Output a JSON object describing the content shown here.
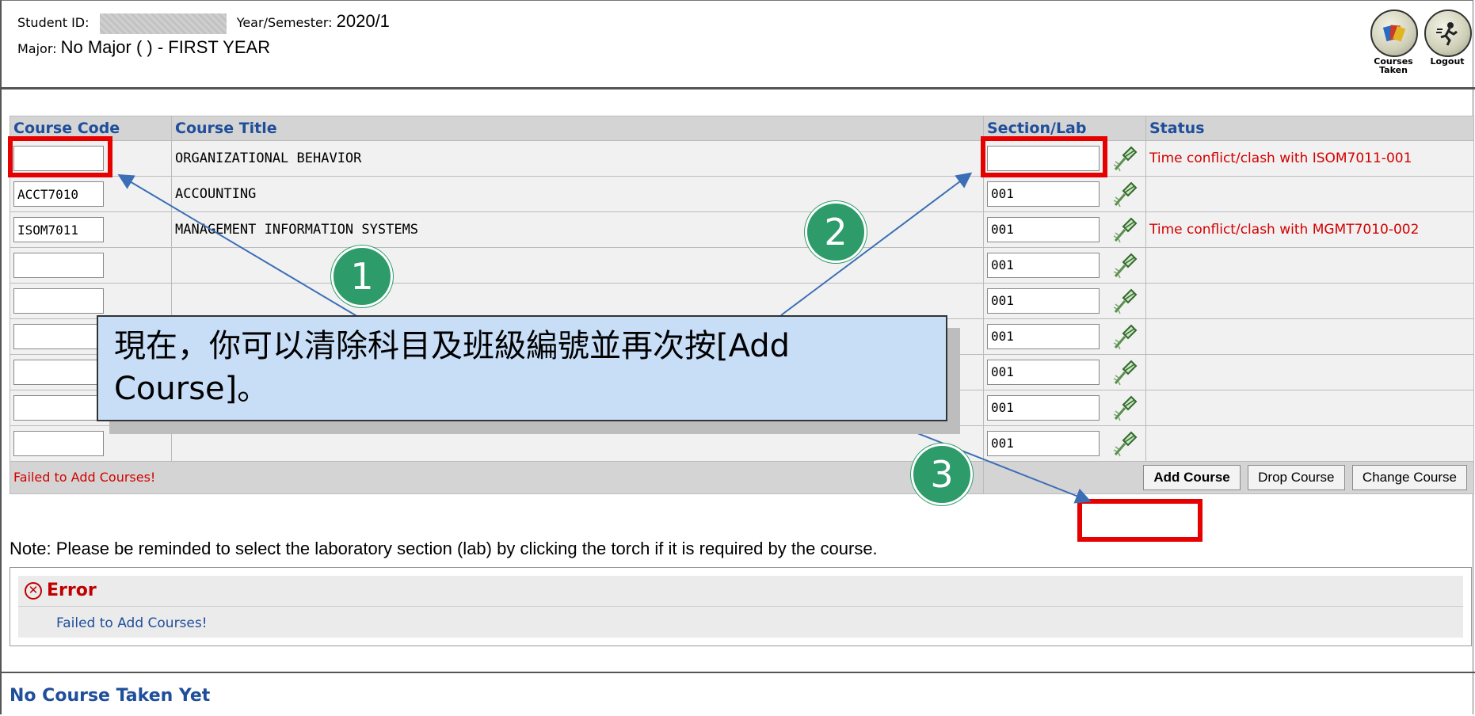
{
  "header": {
    "student_id_label": "Student ID:",
    "year_label": "Year/Semester:",
    "year_value": "2020/1",
    "major_label": "Major:",
    "major_value": "No Major ( ) - FIRST YEAR"
  },
  "top_icons": {
    "courses_taken_line1": "Courses",
    "courses_taken_line2": "Taken",
    "logout": "Logout"
  },
  "table": {
    "headers": [
      "Course Code",
      "Course Title",
      "Section/Lab",
      "Status"
    ],
    "rows": [
      {
        "code": "",
        "title": "ORGANIZATIONAL BEHAVIOR",
        "section": "",
        "status": "Time conflict/clash with ISOM7011-001"
      },
      {
        "code": "ACCT7010",
        "title": "ACCOUNTING",
        "section": "001",
        "status": ""
      },
      {
        "code": "ISOM7011",
        "title": "MANAGEMENT INFORMATION SYSTEMS",
        "section": "001",
        "status": "Time conflict/clash with MGMT7010-002"
      },
      {
        "code": "",
        "title": "",
        "section": "001",
        "status": ""
      },
      {
        "code": "",
        "title": "",
        "section": "001",
        "status": ""
      },
      {
        "code": "",
        "title": "",
        "section": "001",
        "status": ""
      },
      {
        "code": "",
        "title": "",
        "section": "001",
        "status": ""
      },
      {
        "code": "",
        "title": "",
        "section": "001",
        "status": ""
      },
      {
        "code": "",
        "title": "",
        "section": "001",
        "status": ""
      }
    ],
    "fail_message": "Failed to Add Courses!",
    "buttons": {
      "add": "Add Course",
      "drop": "Drop Course",
      "change": "Change Course"
    }
  },
  "note": "Note: Please be reminded to select the laboratory section (lab) by clicking the torch if it is required by the course.",
  "error": {
    "title": "Error",
    "message": "Failed to Add Courses!"
  },
  "no_course": "No Course Taken Yet",
  "callout": {
    "line1": "現在，你可以清除科目及班級編號並再次按[Add",
    "line2": "Course]。"
  },
  "badges": [
    "1",
    "2",
    "3"
  ],
  "colors": {
    "accent_blue": "#1f4e9a",
    "error_red": "#d40000",
    "highlight_red": "#e60000",
    "badge_green": "#2e9b6a",
    "callout_bg": "#c8def7"
  }
}
